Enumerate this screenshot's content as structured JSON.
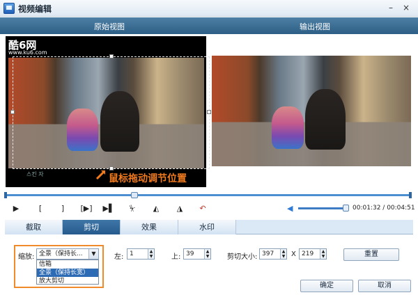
{
  "window": {
    "title": "视频编辑",
    "minimize": "–",
    "close": "×"
  },
  "header": {
    "left": "原始视图",
    "right": "输出视图"
  },
  "preview": {
    "logo": "酷6网",
    "logo_url": "www.ku6.com",
    "subtitle": "스킨 자",
    "caption": "鼠标拖动调节位置"
  },
  "playback": {
    "progress": 0.32,
    "volume": 0.95,
    "current_time": "00:01:32",
    "separator": " / ",
    "total_time": "00:04:51"
  },
  "controls": {
    "play": "▶",
    "mark_in": "[",
    "mark_out": "]",
    "play_selection": "[▶]",
    "skip_segment": "▶▌",
    "split": "⏧",
    "rotate_left": "◭",
    "rotate_right": "◮",
    "undo": "↶",
    "volume_icon": "◀"
  },
  "tabs": [
    {
      "label": "截取"
    },
    {
      "label": "剪切"
    },
    {
      "label": "效果"
    },
    {
      "label": "水印"
    }
  ],
  "crop": {
    "zoom_label": "缩放:",
    "zoom_value": "全景（保持长...",
    "options": [
      "信箱",
      "全景（保持长宽）",
      "放大剪切"
    ],
    "left_label": "左:",
    "left_value": "1",
    "top_label": "上:",
    "top_value": "39",
    "size_label": "剪切大小:",
    "width_value": "397",
    "x_label": "X",
    "height_value": "219",
    "reset": "重置"
  },
  "dialog": {
    "ok": "确定",
    "cancel": "取消"
  },
  "colors": {
    "header": "#2d5f86",
    "accent": "#f07a1e",
    "active_tab": "#255a8c",
    "selection": "#2e6bb5"
  }
}
